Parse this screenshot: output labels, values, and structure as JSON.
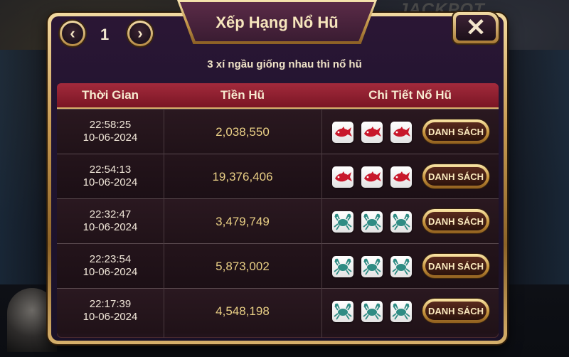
{
  "background": {
    "jackpot_text": "JACKPOT"
  },
  "modal": {
    "title": "Xếp Hạng Nổ Hũ",
    "page_number": "1",
    "prev_icon": "chevron-left-icon",
    "next_icon": "chevron-right-icon",
    "close_icon": "close-icon",
    "subtitle": "3 xí ngầu giống nhau thì nổ hũ"
  },
  "table": {
    "headers": {
      "time": "Thời Gian",
      "money": "Tiền Hũ",
      "detail": "Chi Tiết Nổ Hũ"
    },
    "rows": [
      {
        "time": "22:58:25",
        "date": "10-06-2024",
        "amount": "2,038,550",
        "dice": "red-fish",
        "button": "DANH SÁCH"
      },
      {
        "time": "22:54:13",
        "date": "10-06-2024",
        "amount": "19,376,406",
        "dice": "red-fish",
        "button": "DANH SÁCH"
      },
      {
        "time": "22:32:47",
        "date": "10-06-2024",
        "amount": "3,479,749",
        "dice": "teal-crab",
        "button": "DANH SÁCH"
      },
      {
        "time": "22:23:54",
        "date": "10-06-2024",
        "amount": "5,873,002",
        "dice": "teal-crab",
        "button": "DANH SÁCH"
      },
      {
        "time": "22:17:39",
        "date": "10-06-2024",
        "amount": "4,548,198",
        "dice": "teal-crab",
        "button": "DANH SÁCH"
      }
    ]
  },
  "colors": {
    "header_red": "#a32a3c",
    "gold": "#e9cf85",
    "fish_red": "#c8182b",
    "crab_teal": "#2f8c84"
  }
}
